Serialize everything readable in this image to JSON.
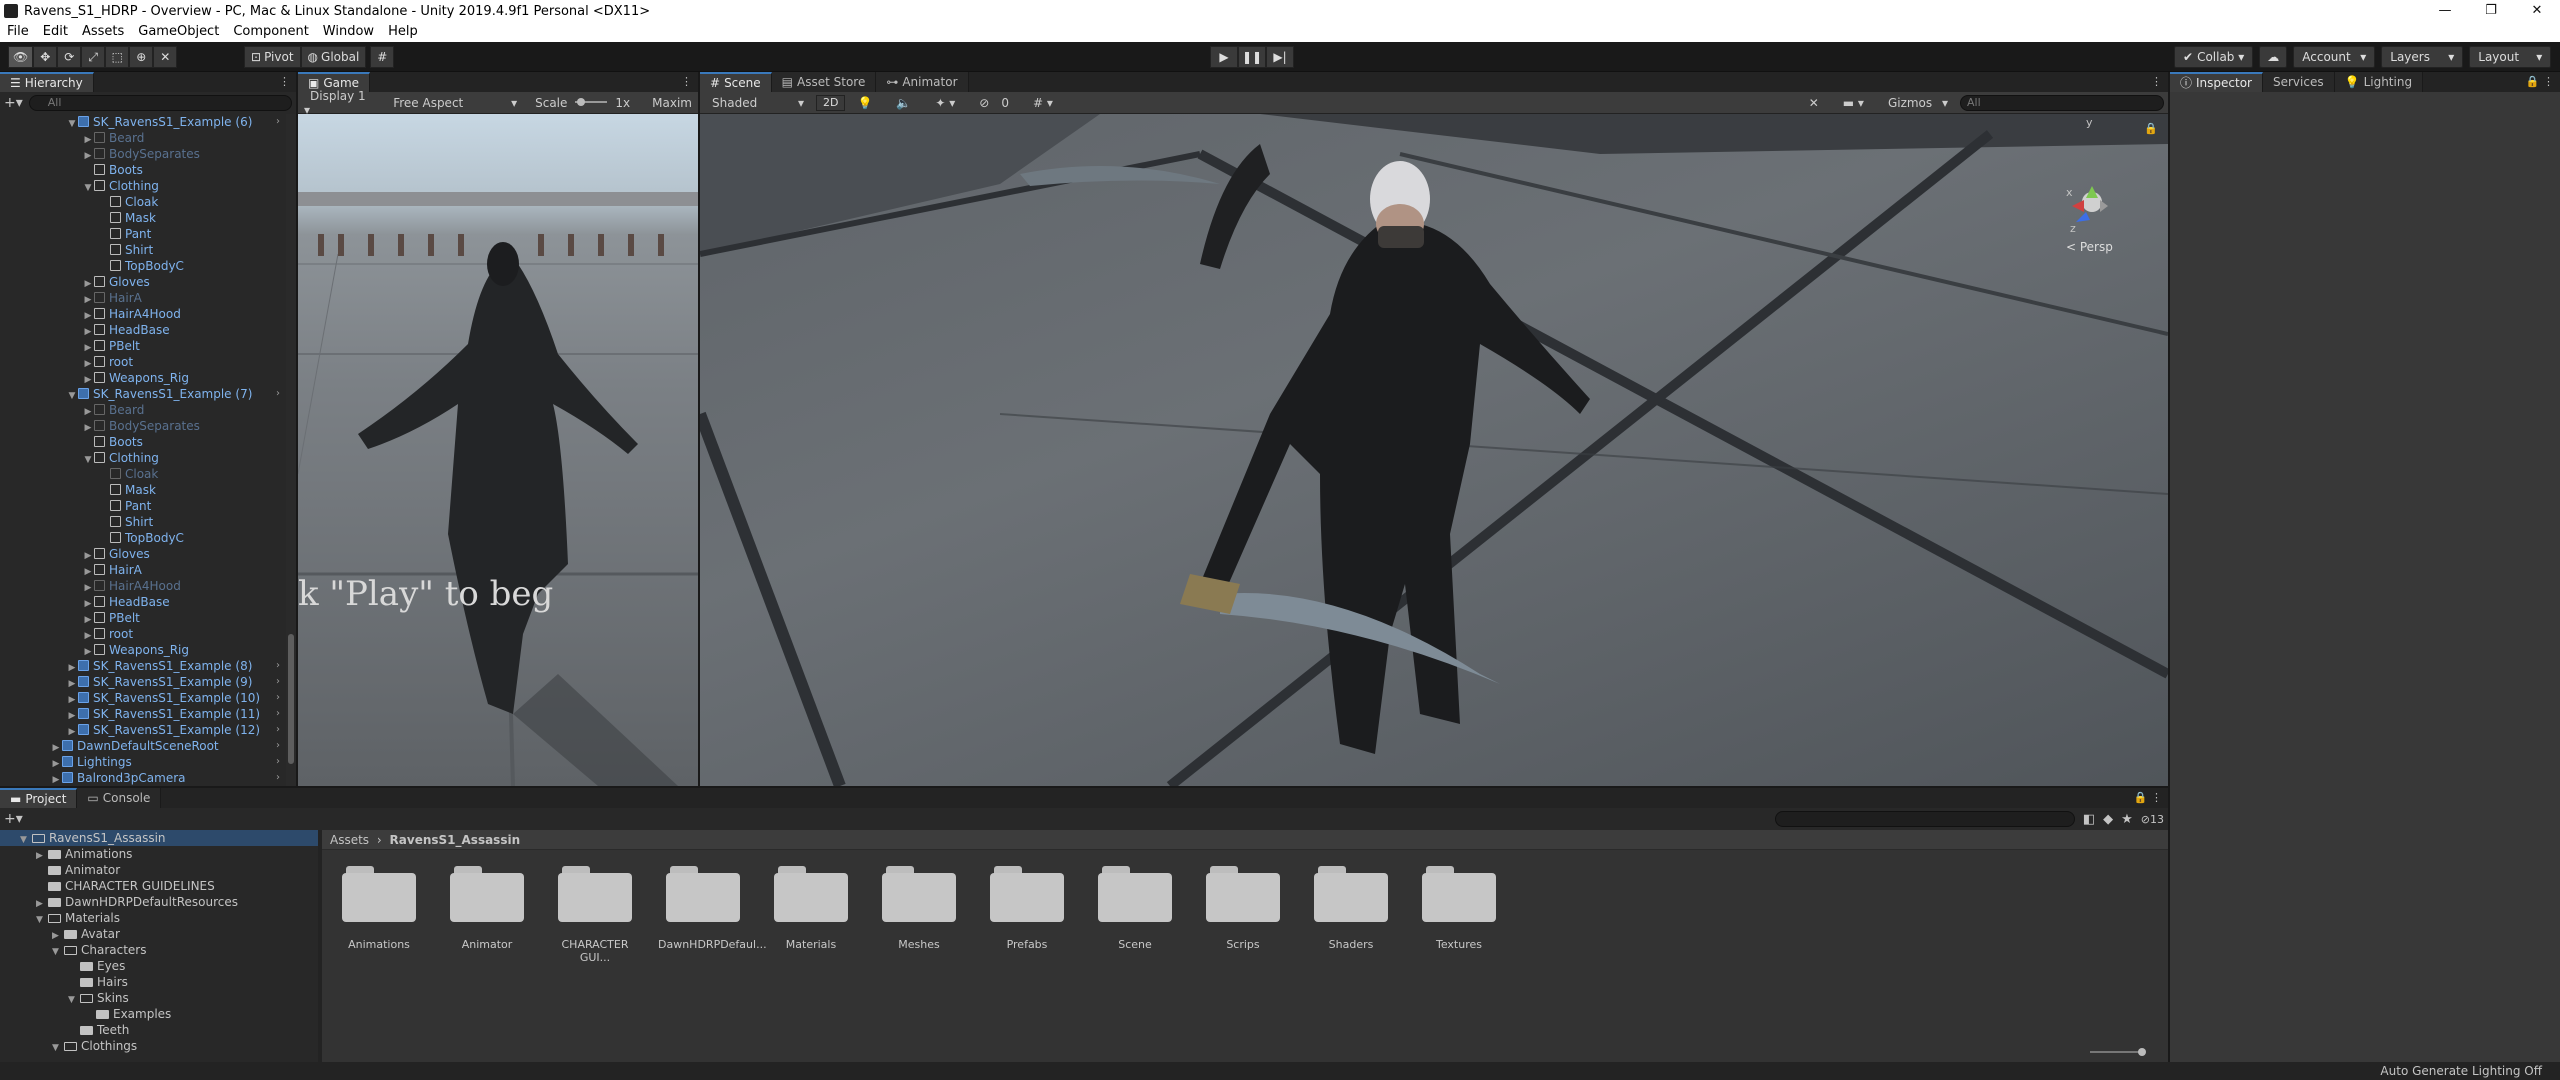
{
  "window": {
    "title": "Ravens_S1_HDRP - Overview - PC, Mac & Linux Standalone - Unity 2019.4.9f1 Personal <DX11>",
    "controls": [
      "—",
      "❐",
      "✕"
    ]
  },
  "menu": [
    "File",
    "Edit",
    "Assets",
    "GameObject",
    "Component",
    "Window",
    "Help"
  ],
  "toolbar": {
    "pivot": "Pivot",
    "global": "Global",
    "collab": "Collab ▾",
    "account": "Account",
    "layers": "Layers",
    "layout": "Layout"
  },
  "hierarchy": {
    "tab": "Hierarchy",
    "search_placeholder": "All",
    "rows": [
      {
        "depth": 1,
        "arrow": "▼",
        "label": "SK_RavensS1_Example (6)",
        "kind": "prefab",
        "more": true
      },
      {
        "depth": 2,
        "arrow": "▶",
        "label": "Beard",
        "kind": "disabled"
      },
      {
        "depth": 2,
        "arrow": "▶",
        "label": "BodySeparates",
        "kind": "disabled"
      },
      {
        "depth": 2,
        "arrow": "",
        "label": "Boots",
        "kind": "prefab"
      },
      {
        "depth": 2,
        "arrow": "▼",
        "label": "Clothing",
        "kind": "prefab"
      },
      {
        "depth": 3,
        "arrow": "",
        "label": "Cloak",
        "kind": "prefab"
      },
      {
        "depth": 3,
        "arrow": "",
        "label": "Mask",
        "kind": "prefab"
      },
      {
        "depth": 3,
        "arrow": "",
        "label": "Pant",
        "kind": "prefab"
      },
      {
        "depth": 3,
        "arrow": "",
        "label": "Shirt",
        "kind": "prefab"
      },
      {
        "depth": 3,
        "arrow": "",
        "label": "TopBodyC",
        "kind": "prefab"
      },
      {
        "depth": 2,
        "arrow": "▶",
        "label": "Gloves",
        "kind": "prefab"
      },
      {
        "depth": 2,
        "arrow": "▶",
        "label": "HairA",
        "kind": "disabled"
      },
      {
        "depth": 2,
        "arrow": "▶",
        "label": "HairA4Hood",
        "kind": "prefab"
      },
      {
        "depth": 2,
        "arrow": "▶",
        "label": "HeadBase",
        "kind": "prefab"
      },
      {
        "depth": 2,
        "arrow": "▶",
        "label": "PBelt",
        "kind": "prefab"
      },
      {
        "depth": 2,
        "arrow": "▶",
        "label": "root",
        "kind": "prefab"
      },
      {
        "depth": 2,
        "arrow": "▶",
        "label": "Weapons_Rig",
        "kind": "prefab"
      },
      {
        "depth": 1,
        "arrow": "▼",
        "label": "SK_RavensS1_Example (7)",
        "kind": "prefab",
        "more": true
      },
      {
        "depth": 2,
        "arrow": "▶",
        "label": "Beard",
        "kind": "disabled"
      },
      {
        "depth": 2,
        "arrow": "▶",
        "label": "BodySeparates",
        "kind": "disabled"
      },
      {
        "depth": 2,
        "arrow": "",
        "label": "Boots",
        "kind": "prefab"
      },
      {
        "depth": 2,
        "arrow": "▼",
        "label": "Clothing",
        "kind": "prefab"
      },
      {
        "depth": 3,
        "arrow": "",
        "label": "Cloak",
        "kind": "disabled"
      },
      {
        "depth": 3,
        "arrow": "",
        "label": "Mask",
        "kind": "prefab"
      },
      {
        "depth": 3,
        "arrow": "",
        "label": "Pant",
        "kind": "prefab"
      },
      {
        "depth": 3,
        "arrow": "",
        "label": "Shirt",
        "kind": "prefab"
      },
      {
        "depth": 3,
        "arrow": "",
        "label": "TopBodyC",
        "kind": "prefab"
      },
      {
        "depth": 2,
        "arrow": "▶",
        "label": "Gloves",
        "kind": "prefab"
      },
      {
        "depth": 2,
        "arrow": "▶",
        "label": "HairA",
        "kind": "prefab"
      },
      {
        "depth": 2,
        "arrow": "▶",
        "label": "HairA4Hood",
        "kind": "disabled"
      },
      {
        "depth": 2,
        "arrow": "▶",
        "label": "HeadBase",
        "kind": "prefab"
      },
      {
        "depth": 2,
        "arrow": "▶",
        "label": "PBelt",
        "kind": "prefab"
      },
      {
        "depth": 2,
        "arrow": "▶",
        "label": "root",
        "kind": "prefab"
      },
      {
        "depth": 2,
        "arrow": "▶",
        "label": "Weapons_Rig",
        "kind": "prefab"
      },
      {
        "depth": 1,
        "arrow": "▶",
        "label": "SK_RavensS1_Example (8)",
        "kind": "prefab",
        "more": true
      },
      {
        "depth": 1,
        "arrow": "▶",
        "label": "SK_RavensS1_Example (9)",
        "kind": "prefab",
        "more": true
      },
      {
        "depth": 1,
        "arrow": "▶",
        "label": "SK_RavensS1_Example (10)",
        "kind": "prefab",
        "more": true
      },
      {
        "depth": 1,
        "arrow": "▶",
        "label": "SK_RavensS1_Example (11)",
        "kind": "prefab",
        "more": true
      },
      {
        "depth": 1,
        "arrow": "▶",
        "label": "SK_RavensS1_Example (12)",
        "kind": "prefab",
        "more": true
      },
      {
        "depth": 0,
        "arrow": "▶",
        "label": "DawnDefaultSceneRoot",
        "kind": "prefab",
        "more": true
      },
      {
        "depth": 0,
        "arrow": "▶",
        "label": "Lightings",
        "kind": "prefab",
        "more": true
      },
      {
        "depth": 0,
        "arrow": "▶",
        "label": "Balrond3pCamera",
        "kind": "prefab",
        "more": true
      }
    ]
  },
  "game": {
    "tab": "Game",
    "display": "Display 1",
    "aspect": "Free Aspect",
    "scale_label": "Scale",
    "scale_value": "1x",
    "maximize": "Maxim",
    "overlay_text": "k \"Play\" to beg"
  },
  "scene": {
    "tabs": [
      "Scene",
      "Asset Store",
      "Animator"
    ],
    "shading": "Shaded",
    "mode_2d": "2D",
    "fx_count": "0",
    "gizmos": "Gizmos",
    "search_placeholder": "All",
    "projection": "< Persp",
    "axes": {
      "x": "x",
      "y": "y",
      "z": "z"
    }
  },
  "inspector": {
    "tabs": [
      "Inspector",
      "Services",
      "Lighting"
    ]
  },
  "project": {
    "tabs": [
      "Project",
      "Console"
    ],
    "hidden_count": "13",
    "tree": [
      {
        "depth": 0,
        "arrow": "▼",
        "label": "RavensS1_Assassin",
        "open": true
      },
      {
        "depth": 1,
        "arrow": "▶",
        "label": "Animations"
      },
      {
        "depth": 1,
        "arrow": "",
        "label": "Animator"
      },
      {
        "depth": 1,
        "arrow": "",
        "label": "CHARACTER GUIDELINES"
      },
      {
        "depth": 1,
        "arrow": "▶",
        "label": "DawnHDRPDefaultResources"
      },
      {
        "depth": 1,
        "arrow": "▼",
        "label": "Materials",
        "open": true
      },
      {
        "depth": 2,
        "arrow": "▶",
        "label": "Avatar"
      },
      {
        "depth": 2,
        "arrow": "▼",
        "label": "Characters",
        "open": true
      },
      {
        "depth": 3,
        "arrow": "",
        "label": "Eyes"
      },
      {
        "depth": 3,
        "arrow": "",
        "label": "Hairs"
      },
      {
        "depth": 3,
        "arrow": "▼",
        "label": "Skins",
        "open": true
      },
      {
        "depth": 4,
        "arrow": "",
        "label": "Examples"
      },
      {
        "depth": 3,
        "arrow": "",
        "label": "Teeth"
      },
      {
        "depth": 2,
        "arrow": "▼",
        "label": "Clothings",
        "open": true
      }
    ],
    "breadcrumb": [
      "Assets",
      "RavensS1_Assassin"
    ],
    "folders": [
      "Animations",
      "Animator",
      "CHARACTER GUI...",
      "DawnHDRPDefaul...",
      "Materials",
      "Meshes",
      "Prefabs",
      "Scene",
      "Scrips",
      "Shaders",
      "Textures"
    ]
  },
  "status": {
    "right": "Auto Generate Lighting Off"
  },
  "colors": {
    "prefab": "#7fb3ee",
    "disabled": "#59718f",
    "accent": "#3a79bb"
  }
}
